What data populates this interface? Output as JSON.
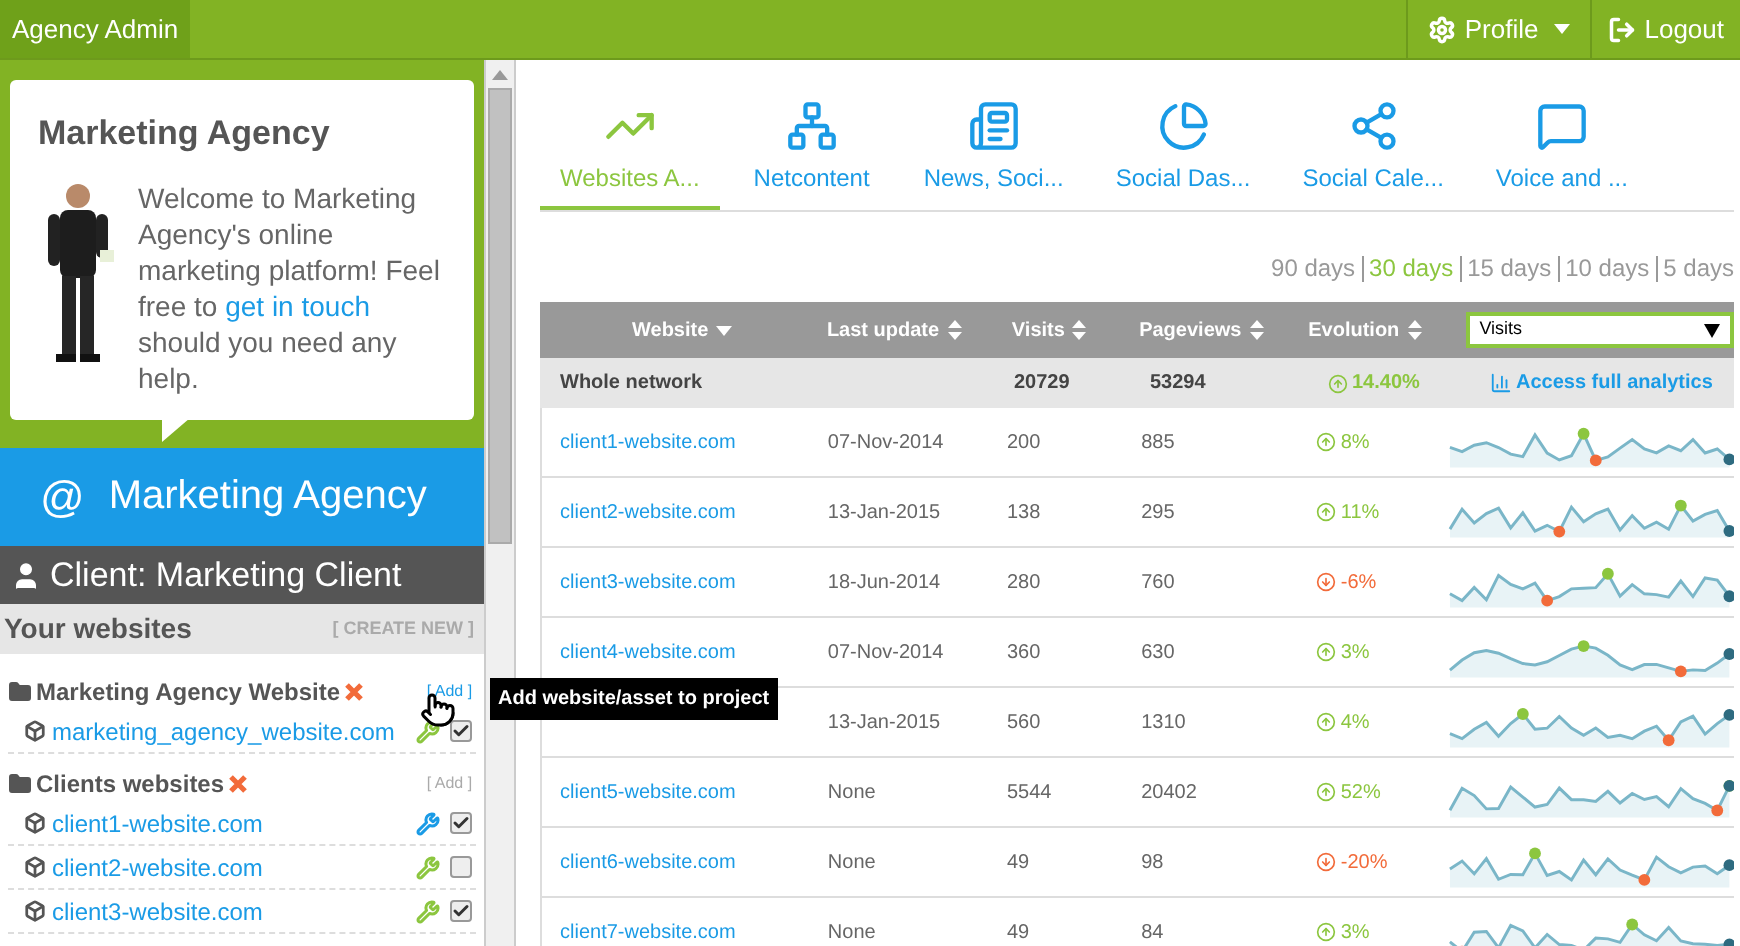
{
  "topbar": {
    "title": "Agency Admin",
    "profile": "Profile",
    "logout": "Logout"
  },
  "welcome": {
    "title": "Marketing Agency",
    "text_before": "Welcome to Marketing Agency's online marketing platform! Feel free to",
    "link": "get in touch",
    "text_after": "should you need any help."
  },
  "brand": {
    "icon": "@",
    "name": "Marketing Agency"
  },
  "client": {
    "label": "Client: Marketing Client"
  },
  "websites": {
    "title": "Your websites",
    "create_new": "[ CREATE NEW ]",
    "groups": [
      {
        "name": "Marketing Agency Website",
        "add": "[ Add ]",
        "hovered": true,
        "items": [
          {
            "name": "marketing_agency_website.com",
            "checked": true,
            "color": "#8cc63f"
          }
        ]
      },
      {
        "name": "Clients websites",
        "add": "[ Add ]",
        "hovered": false,
        "items": [
          {
            "name": "client1-website.com",
            "checked": true,
            "color": "#1a9be6"
          },
          {
            "name": "client2-website.com",
            "checked": false,
            "color": "#8cc63f"
          },
          {
            "name": "client3-website.com",
            "checked": true,
            "color": "#8cc63f"
          }
        ]
      }
    ]
  },
  "tooltip": "Add website/asset to project",
  "tabs": [
    {
      "label": "Websites A...",
      "selected": true
    },
    {
      "label": "Netcontent",
      "selected": false
    },
    {
      "label": "News, Soci...",
      "selected": false
    },
    {
      "label": "Social Das...",
      "selected": false
    },
    {
      "label": "Social Cale...",
      "selected": false
    },
    {
      "label": "Voice and ...",
      "selected": false
    }
  ],
  "periods": [
    {
      "label": "90 days",
      "selected": false
    },
    {
      "label": "30 days",
      "selected": true
    },
    {
      "label": "15 days",
      "selected": false
    },
    {
      "label": "10 days",
      "selected": false
    },
    {
      "label": "5 days",
      "selected": false
    }
  ],
  "table": {
    "columns": [
      {
        "label": "Website",
        "sorted": true
      },
      {
        "label": "Last update",
        "sorted": false
      },
      {
        "label": "Visits",
        "sorted": false
      },
      {
        "label": "Pageviews",
        "sorted": false
      },
      {
        "label": "Evolution",
        "sorted": false
      }
    ],
    "metric_select": "Visits",
    "summary": {
      "name": "Whole network",
      "visits": "20729",
      "pageviews": "53294",
      "evolution": "14.40%",
      "link": "Access full analytics"
    },
    "rows": [
      {
        "website": "client1-website.com",
        "last_update": "07-Nov-2014",
        "visits": "200",
        "pageviews": "885",
        "evolution": "8%",
        "rising": true
      },
      {
        "website": "client2-website.com",
        "last_update": "13-Jan-2015",
        "visits": "138",
        "pageviews": "295",
        "evolution": "11%",
        "rising": true
      },
      {
        "website": "client3-website.com",
        "last_update": "18-Jun-2014",
        "visits": "280",
        "pageviews": "760",
        "evolution": "-6%",
        "rising": false
      },
      {
        "website": "client4-website.com",
        "last_update": "07-Nov-2014",
        "visits": "360",
        "pageviews": "630",
        "evolution": "3%",
        "rising": true
      },
      {
        "last_update": "13-Jan-2015",
        "visits": "560",
        "pageviews": "1310",
        "evolution": "4%",
        "rising": true
      },
      {
        "website": "client5-website.com",
        "last_update": "None",
        "visits": "5544",
        "pageviews": "20402",
        "evolution": "52%",
        "rising": true
      },
      {
        "website": "client6-website.com",
        "last_update": "None",
        "visits": "49",
        "pageviews": "98",
        "evolution": "-20%",
        "rising": false
      },
      {
        "website": "client7-website.com",
        "last_update": "None",
        "visits": "49",
        "pageviews": "84",
        "evolution": "3%",
        "rising": true
      }
    ]
  }
}
